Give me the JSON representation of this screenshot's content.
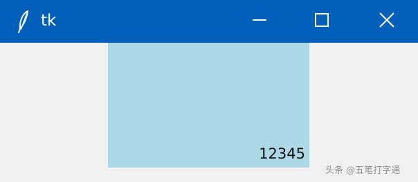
{
  "window": {
    "title": "tk",
    "titlebar_color": "#005fb8",
    "client_background": "#f0f0f0",
    "app_icon": "tk-feather-icon",
    "controls": {
      "minimize_icon": "minimize-icon",
      "maximize_icon": "maximize-icon",
      "close_icon": "close-icon"
    }
  },
  "label": {
    "text": "12345",
    "background": "#add8e6",
    "anchor": "bottom-right"
  },
  "watermark": {
    "text": "头条 @五笔打字通"
  }
}
